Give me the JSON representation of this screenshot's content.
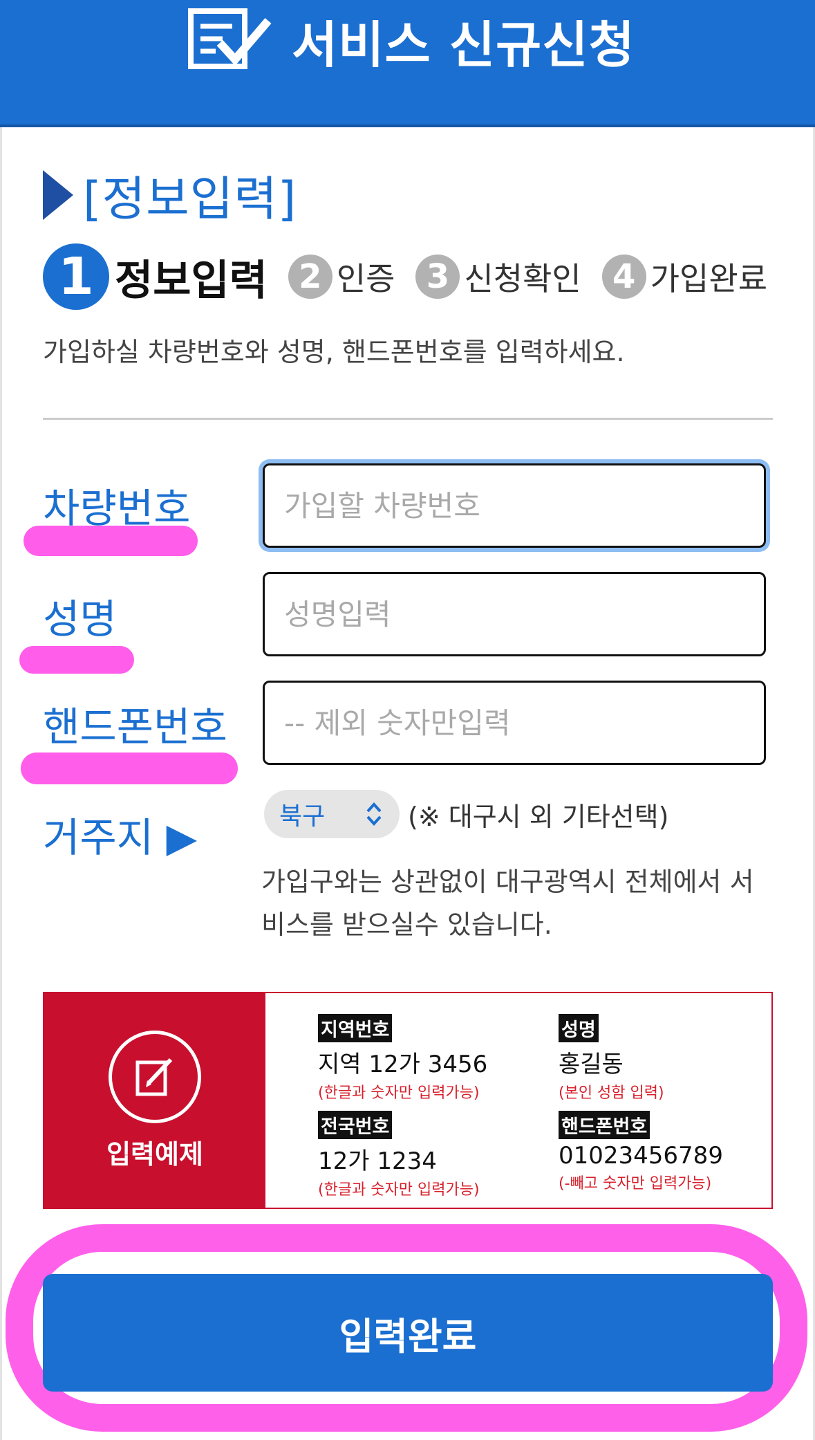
{
  "header": {
    "title": "서비스 신규신청",
    "icon": "form-check-icon"
  },
  "section": {
    "title": "[정보입력]"
  },
  "steps": [
    {
      "num": "1",
      "label": "정보입력",
      "active": true
    },
    {
      "num": "2",
      "label": "인증",
      "active": false
    },
    {
      "num": "3",
      "label": "신청확인",
      "active": false
    },
    {
      "num": "4",
      "label": "가입완료",
      "active": false
    }
  ],
  "instruction": "가입하실 차량번호와 성명, 핸드폰번호를 입력하세요.",
  "form": {
    "vehicle": {
      "label": "차량번호",
      "placeholder": "가입할 차량번호",
      "value": ""
    },
    "name": {
      "label": "성명",
      "placeholder": "성명입력",
      "value": ""
    },
    "phone": {
      "label": "핸드폰번호",
      "placeholder": "-- 제외 숫자만입력",
      "value": ""
    },
    "residence": {
      "label": "거주지 ▶",
      "selected": "북구",
      "note": "(※ 대구시 외 기타선택)"
    },
    "notice": "가입구와는 상관없이 대구광역시 전체에서 서비스를 받으실수 있습니다."
  },
  "example": {
    "title": "입력예제",
    "items": [
      {
        "tag": "지역번호",
        "value": "지역 12가 3456",
        "hint": "(한글과 숫자만 입력가능)"
      },
      {
        "tag": "성명",
        "value": "홍길동",
        "hint": "(본인 성함 입력)"
      },
      {
        "tag": "전국번호",
        "value": "12가 1234",
        "hint": "(한글과 숫자만 입력가능)"
      },
      {
        "tag": "핸드폰번호",
        "value": "01023456789",
        "hint": "(-빼고 숫자만 입력가능)"
      }
    ]
  },
  "submit": {
    "label": "입력완료"
  },
  "colors": {
    "primary": "#1b6fd1",
    "accent": "#c8102e",
    "highlight": "#ff4fe8"
  }
}
